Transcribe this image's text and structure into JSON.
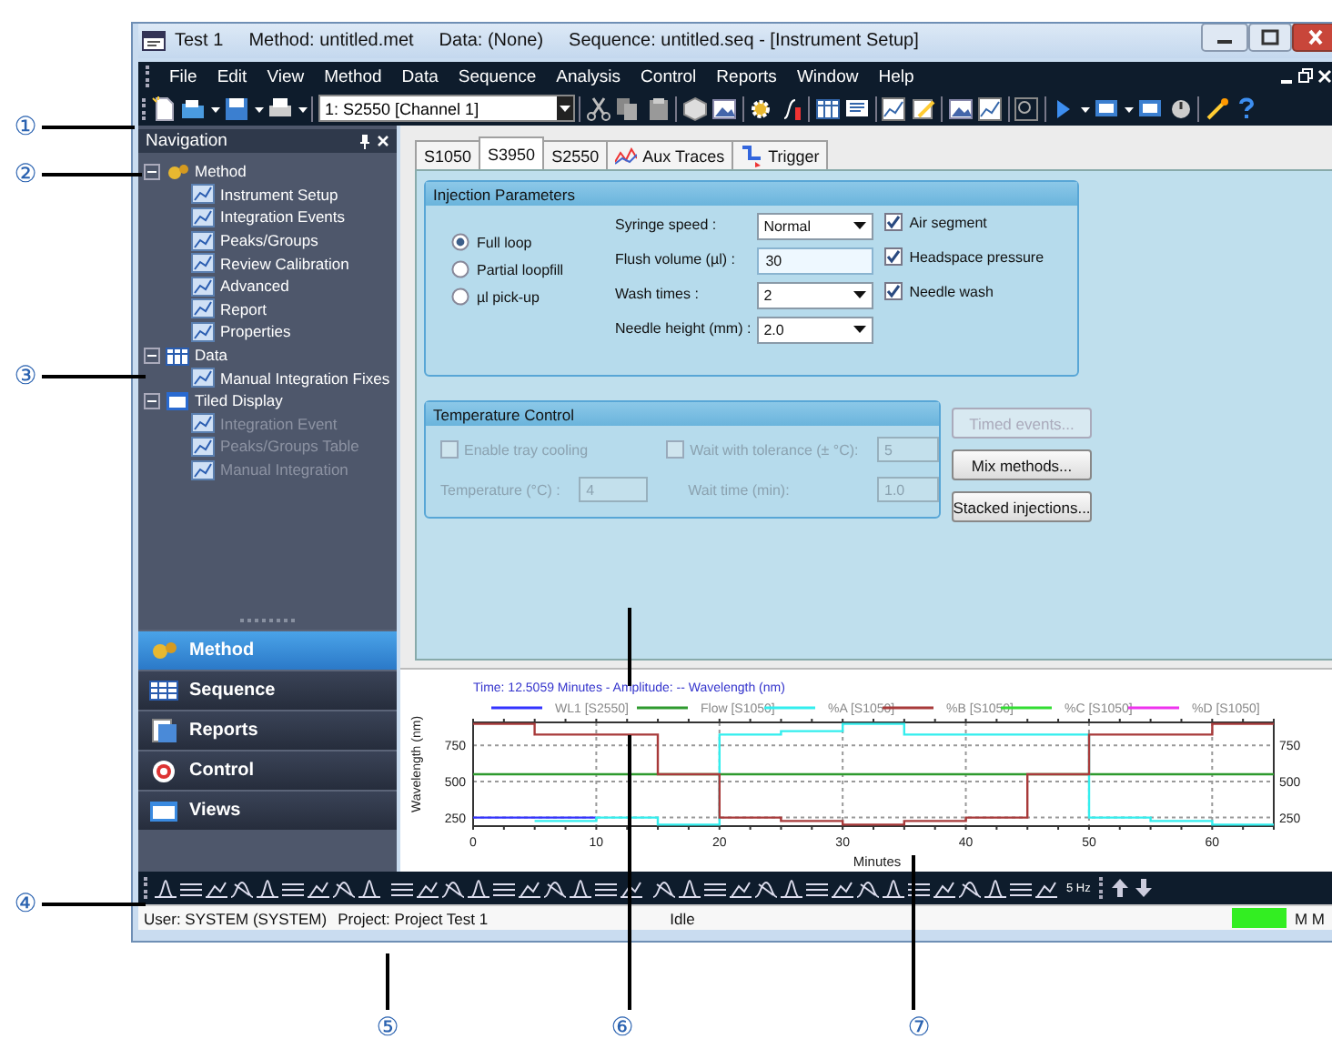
{
  "callouts": [
    {
      "label": "①"
    },
    {
      "label": "②"
    },
    {
      "label": "③"
    },
    {
      "label": "④"
    },
    {
      "label": "⑤"
    },
    {
      "label": "⑥"
    },
    {
      "label": "⑦"
    }
  ],
  "window": {
    "title_parts": [
      "Test 1",
      "Method: untitled.met",
      "Data: (None)",
      "Sequence: untitled.seq - [Instrument Setup]"
    ]
  },
  "menu": [
    "File",
    "Edit",
    "View",
    "Method",
    "Data",
    "Sequence",
    "Analysis",
    "Control",
    "Reports",
    "Window",
    "Help"
  ],
  "toolbar": {
    "channel_select": "1: S2550 [Channel 1]"
  },
  "navigation": {
    "title": "Navigation",
    "tree": [
      {
        "label": "Method",
        "expanded": true,
        "disabled": false,
        "children": [
          {
            "label": "Instrument Setup",
            "disabled": false
          },
          {
            "label": "Integration Events",
            "disabled": false
          },
          {
            "label": "Peaks/Groups",
            "disabled": false
          },
          {
            "label": "Review Calibration",
            "disabled": false
          },
          {
            "label": "Advanced",
            "disabled": false
          },
          {
            "label": "Report",
            "disabled": false
          },
          {
            "label": "Properties",
            "disabled": false
          }
        ]
      },
      {
        "label": "Data",
        "expanded": true,
        "disabled": false,
        "children": [
          {
            "label": "Manual Integration Fixes",
            "disabled": false
          }
        ]
      },
      {
        "label": "Tiled Display",
        "expanded": true,
        "disabled": false,
        "children": [
          {
            "label": "Integration Event",
            "disabled": true
          },
          {
            "label": "Peaks/Groups Table",
            "disabled": true
          },
          {
            "label": "Manual Integration",
            "disabled": true
          }
        ]
      }
    ],
    "buttons": [
      {
        "label": "Method",
        "selected": true
      },
      {
        "label": "Sequence",
        "selected": false
      },
      {
        "label": "Reports",
        "selected": false
      },
      {
        "label": "Control",
        "selected": false
      },
      {
        "label": "Views",
        "selected": false
      }
    ]
  },
  "tabs": [
    {
      "label": "S1050",
      "selected": false,
      "kind": "plain"
    },
    {
      "label": "S3950",
      "selected": true,
      "kind": "plain"
    },
    {
      "label": "S2550",
      "selected": false,
      "kind": "plain"
    },
    {
      "label": "Aux Traces",
      "selected": false,
      "kind": "traces"
    },
    {
      "label": "Trigger",
      "selected": false,
      "kind": "trigger"
    }
  ],
  "injection": {
    "title": "Injection Parameters",
    "modes": [
      {
        "label": "Full loop",
        "selected": true
      },
      {
        "label": "Partial loopfill",
        "selected": false
      },
      {
        "label": "µl pick-up",
        "selected": false
      }
    ],
    "fields": [
      {
        "label": "Syringe speed :",
        "kind": "select",
        "value": "Normal"
      },
      {
        "label": "Flush volume (µl) :",
        "kind": "input",
        "value": "30"
      },
      {
        "label": "Wash times :",
        "kind": "select",
        "value": "2"
      },
      {
        "label": "Needle height (mm) :",
        "kind": "select",
        "value": "2.0"
      }
    ],
    "options": [
      {
        "label": "Air segment",
        "checked": true
      },
      {
        "label": "Headspace pressure",
        "checked": true
      },
      {
        "label": "Needle wash",
        "checked": true
      }
    ]
  },
  "temperature": {
    "title": "Temperature Control",
    "disabled": true,
    "tray_cooling": {
      "label": "Enable tray cooling",
      "checked": false
    },
    "wait_tolerance": {
      "label": "Wait with tolerance (± °C):",
      "checked": false,
      "value": "5"
    },
    "temperature": {
      "label": "Temperature (°C) :",
      "value": "4"
    },
    "wait_time": {
      "label": "Wait time (min):",
      "value": "1.0"
    }
  },
  "action_buttons": [
    {
      "label": "Timed events...",
      "disabled": true
    },
    {
      "label": "Mix methods...",
      "disabled": false
    },
    {
      "label": "Stacked injections...",
      "disabled": false
    }
  ],
  "chart": {
    "cursor_readout": "Time: 12.5059 Minutes - Amplitude: -- Wavelength (nm)",
    "left_yticks": [
      "750",
      "500",
      "250"
    ],
    "right_yticks": [
      "750",
      "500",
      "250"
    ],
    "xtick_labels": [
      "0",
      "10",
      "20",
      "30",
      "40",
      "50",
      "60"
    ],
    "chart_data": {
      "type": "line",
      "xlabel": "Minutes",
      "ylabel": "Wavelength (nm)",
      "x": [
        0,
        5,
        5,
        10,
        10,
        15,
        15,
        20,
        20,
        25,
        25,
        30,
        30,
        35,
        35,
        40,
        40,
        45,
        45,
        50,
        50,
        55,
        55,
        60,
        60,
        65
      ],
      "series": [
        {
          "name": "WL1 [S2550]",
          "color": "#3333ff",
          "values": [
            250,
            250,
            250,
            250,
            null,
            null,
            null,
            null,
            null,
            null,
            null,
            null,
            null,
            null,
            null,
            null,
            null,
            null,
            null,
            null,
            null,
            null,
            null,
            null,
            null,
            null
          ]
        },
        {
          "name": "Flow [S1050]",
          "color": "#2e9a2e",
          "values": [
            550,
            550,
            550,
            550,
            550,
            550,
            550,
            550,
            550,
            550,
            550,
            550,
            550,
            550,
            550,
            550,
            550,
            550,
            550,
            550,
            550,
            550,
            550,
            550,
            550,
            550
          ]
        },
        {
          "name": "%A [S1050]",
          "color": "#33eeee",
          "values": [
            null,
            null,
            225,
            225,
            250,
            250,
            200,
            200,
            825,
            825,
            850,
            850,
            900,
            900,
            825,
            825,
            825,
            825,
            825,
            825,
            250,
            250,
            225,
            225,
            200,
            200
          ]
        },
        {
          "name": "%B [S1050]",
          "color": "#a83a3a",
          "values": [
            900,
            900,
            825,
            825,
            825,
            825,
            550,
            550,
            250,
            250,
            225,
            225,
            200,
            200,
            225,
            225,
            250,
            250,
            550,
            550,
            825,
            825,
            825,
            825,
            900,
            900
          ]
        },
        {
          "name": "%C [S1050]",
          "color": "#33dd33",
          "values": [
            null,
            null,
            null,
            null,
            null,
            null,
            null,
            null,
            null,
            null,
            null,
            null,
            null,
            null,
            null,
            null,
            null,
            null,
            null,
            null,
            null,
            null,
            null,
            null,
            null,
            null
          ]
        },
        {
          "name": "%D [S1050]",
          "color": "#ee33ee",
          "values": [
            null,
            null,
            null,
            null,
            null,
            null,
            null,
            null,
            null,
            null,
            null,
            null,
            null,
            null,
            null,
            null,
            null,
            null,
            null,
            null,
            null,
            null,
            null,
            null,
            null,
            null
          ]
        }
      ],
      "xlim": [
        0,
        65
      ],
      "ylim": [
        190,
        910
      ],
      "grid": true,
      "legend": true,
      "xticks": [
        0,
        10,
        20,
        30,
        40,
        50,
        60
      ],
      "yticks": [
        250,
        500,
        750
      ]
    }
  },
  "bottom_toolbar": {
    "rate": "5 Hz"
  },
  "status": {
    "user": "User: SYSTEM (SYSTEM)",
    "project": "Project: Project Test 1",
    "state": "Idle",
    "indicator": "M M"
  }
}
